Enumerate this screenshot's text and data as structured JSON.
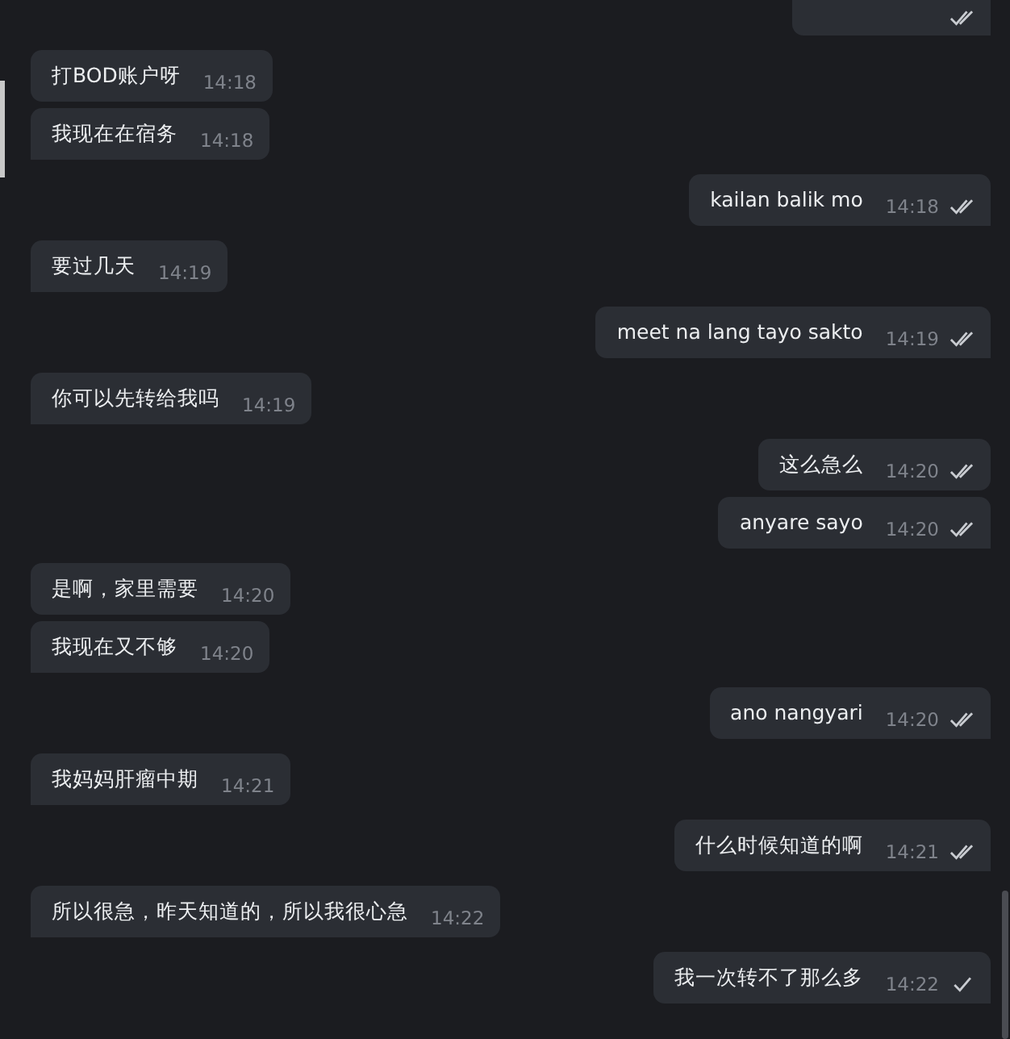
{
  "messages": [
    {
      "outgoing": true,
      "read": true,
      "cut_off": true
    },
    {
      "outgoing": false,
      "text": "打BOD账户呀",
      "time": "14:18"
    },
    {
      "outgoing": false,
      "text": "我现在在宿务",
      "time": "14:18"
    },
    {
      "outgoing": true,
      "text": "kailan balik mo",
      "time": "14:18",
      "read": true
    },
    {
      "outgoing": false,
      "text": "要过几天",
      "time": "14:19"
    },
    {
      "outgoing": true,
      "text": "meet na lang tayo sakto",
      "time": "14:19",
      "read": true
    },
    {
      "outgoing": false,
      "text": "你可以先转给我吗",
      "time": "14:19"
    },
    {
      "outgoing": true,
      "text": "这么急么",
      "time": "14:20",
      "read": true
    },
    {
      "outgoing": true,
      "text": "anyare sayo",
      "time": "14:20",
      "read": true
    },
    {
      "outgoing": false,
      "text": "是啊，家里需要",
      "time": "14:20"
    },
    {
      "outgoing": false,
      "text": "我现在又不够",
      "time": "14:20"
    },
    {
      "outgoing": true,
      "text": "ano nangyari",
      "time": "14:20",
      "read": true
    },
    {
      "outgoing": false,
      "text": "我妈妈肝瘤中期",
      "time": "14:21"
    },
    {
      "outgoing": true,
      "text": "什么时候知道的啊",
      "time": "14:21",
      "read": true
    },
    {
      "outgoing": false,
      "text": "所以很急，昨天知道的，所以我很心急",
      "time": "14:22"
    },
    {
      "outgoing": true,
      "text": "我一次转不了那么多",
      "time": "14:22",
      "read": false
    }
  ]
}
